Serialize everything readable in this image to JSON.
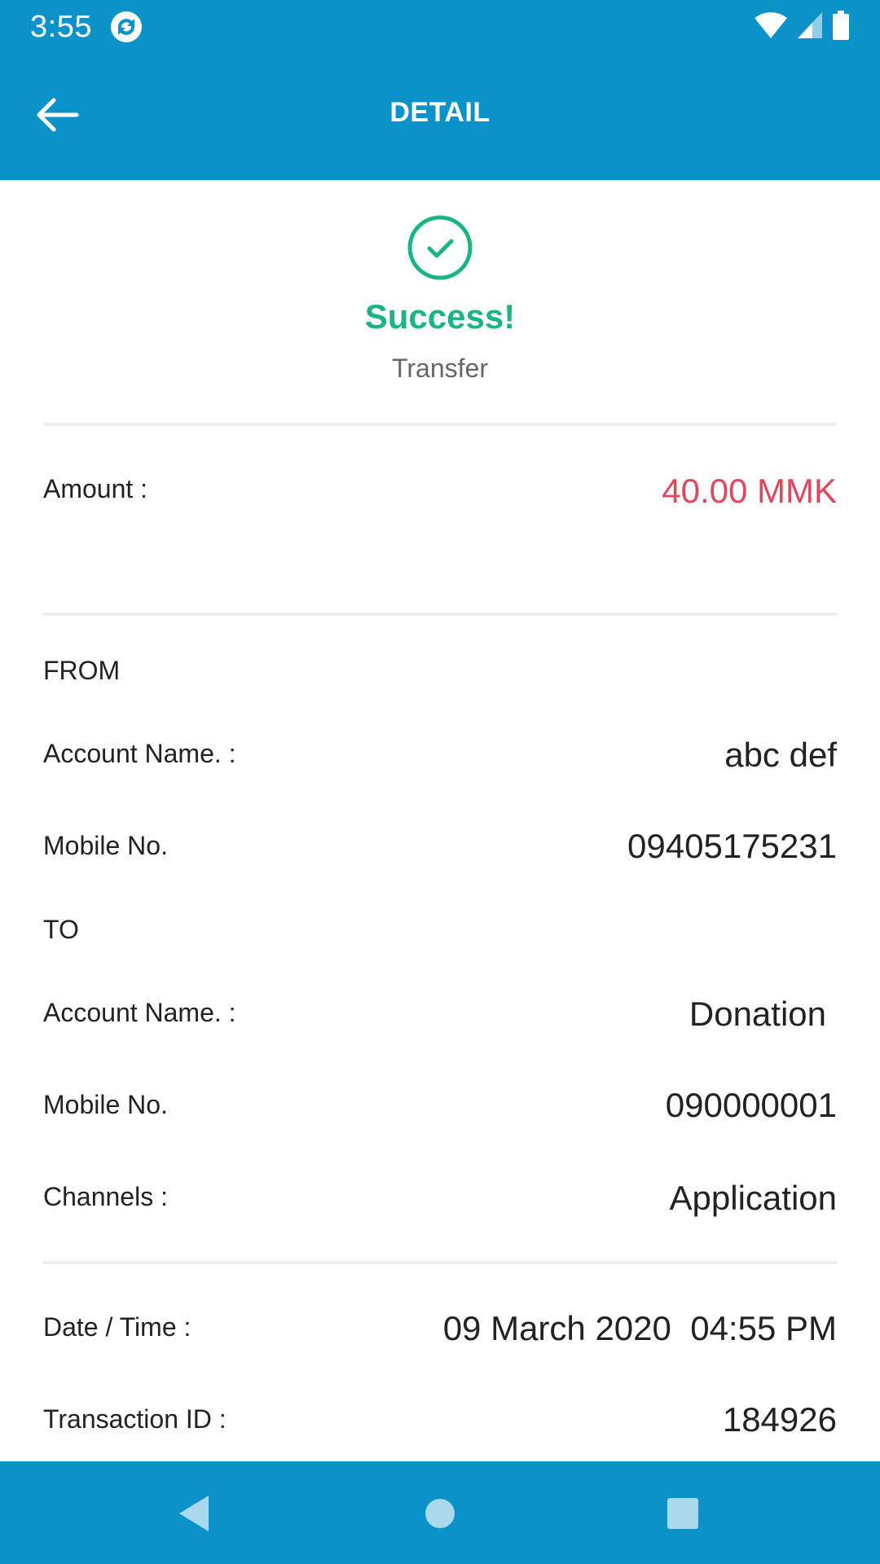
{
  "status_bar": {
    "time": "3:55",
    "icons": [
      "app-sync-icon",
      "wifi-icon",
      "signal-icon",
      "battery-icon"
    ]
  },
  "header": {
    "title": "DETAIL",
    "back_icon": "arrow-left-icon"
  },
  "result": {
    "icon": "check-circle-icon",
    "status": "Success!",
    "type": "Transfer"
  },
  "amount": {
    "label": "Amount :",
    "value": "40.00 MMK"
  },
  "from": {
    "section": "FROM",
    "account_name_label": "Account Name. :",
    "account_name": "abc def",
    "mobile_label": "Mobile No.",
    "mobile": "09405175231"
  },
  "to": {
    "section": "TO",
    "account_name_label": "Account Name. :",
    "account_name": "Donation",
    "mobile_label": "Mobile No.",
    "mobile": "090000001"
  },
  "channels": {
    "label": "Channels :",
    "value": "Application"
  },
  "datetime": {
    "label": "Date / Time :",
    "value": "09 March 2020  04:55 PM"
  },
  "transaction": {
    "label": "Transaction ID :",
    "value": "184926"
  },
  "nav": {
    "icons": [
      "back-triangle-icon",
      "home-circle-icon",
      "recents-square-icon"
    ]
  },
  "colors": {
    "primary": "#0b93c9",
    "success": "#1bb585",
    "amount": "#e1475c"
  }
}
